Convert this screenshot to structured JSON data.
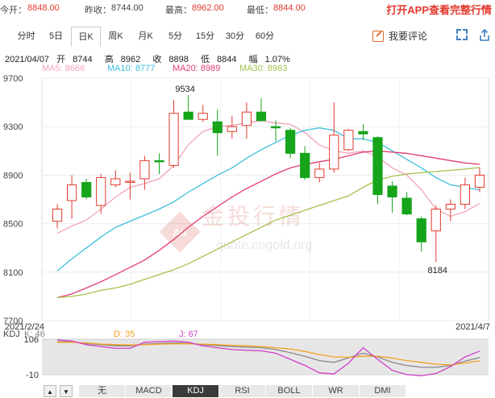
{
  "quote": {
    "open_label": "今开：",
    "open": "8848.00",
    "prev_close_label": "昨收：",
    "prev_close": "8744.00",
    "high_label": "最高：",
    "high": "8962.00",
    "low_label": "最低：",
    "low": "8844.00"
  },
  "promo": "打开APP查看完整行情",
  "tabs": [
    "分时",
    "5日",
    "日K",
    "周K",
    "月K",
    "5分",
    "15分",
    "30分",
    "60分"
  ],
  "active_tab": "日K",
  "comment_button": "我要评论",
  "ohlc": {
    "date": "2021/04/07",
    "open_label": "开",
    "open": "8744",
    "high_label": "高",
    "high": "8962",
    "close_label": "收",
    "close": "8898",
    "low_label": "低",
    "low": "8844",
    "change_label": "幅",
    "change": "1.07%"
  },
  "ma_legend": {
    "ma5": "MA5: 8666",
    "ma10": "MA10: 8777",
    "ma20": "MA20: 8989",
    "ma30": "MA30: 8963"
  },
  "colors": {
    "up": "#e23a2e",
    "down": "#15a41a",
    "ma5": "#f3a3b7",
    "ma10": "#3cbfe0",
    "ma20": "#e23d6f",
    "ma30": "#a3c24a",
    "k": "#888888",
    "d": "#f4a020",
    "j": "#d23fc8"
  },
  "watermark": {
    "cn": "金投行情",
    "url": "quote.cngold.org",
    "logo": "Au"
  },
  "chart_data": {
    "type": "candlestick",
    "ylim": [
      7700,
      9700
    ],
    "yticks": [
      9700,
      9300,
      8900,
      8500,
      8100,
      7700
    ],
    "x_start_label": "2021/2/24",
    "x_end_label": "2021/4/7",
    "max_label": "9534",
    "min_label": "8184",
    "candles": [
      {
        "o": 8520,
        "c": 8620,
        "h": 8660,
        "l": 8460
      },
      {
        "o": 8690,
        "c": 8820,
        "h": 8900,
        "l": 8540
      },
      {
        "o": 8840,
        "c": 8720,
        "h": 8870,
        "l": 8700
      },
      {
        "o": 8650,
        "c": 8880,
        "h": 8910,
        "l": 8580
      },
      {
        "o": 8820,
        "c": 8870,
        "h": 8940,
        "l": 8800
      },
      {
        "o": 8840,
        "c": 8850,
        "h": 8920,
        "l": 8700
      },
      {
        "o": 8870,
        "c": 9020,
        "h": 9060,
        "l": 8780
      },
      {
        "o": 9020,
        "c": 9010,
        "h": 9080,
        "l": 8910
      },
      {
        "o": 8980,
        "c": 9410,
        "h": 9520,
        "l": 8960
      },
      {
        "o": 9420,
        "c": 9360,
        "h": 9560,
        "l": 9360
      },
      {
        "o": 9360,
        "c": 9410,
        "h": 9480,
        "l": 9340
      },
      {
        "o": 9340,
        "c": 9250,
        "h": 9440,
        "l": 9060
      },
      {
        "o": 9260,
        "c": 9300,
        "h": 9390,
        "l": 9200
      },
      {
        "o": 9310,
        "c": 9420,
        "h": 9500,
        "l": 9200
      },
      {
        "o": 9420,
        "c": 9350,
        "h": 9534,
        "l": 9340
      },
      {
        "o": 9300,
        "c": 9290,
        "h": 9350,
        "l": 9180
      },
      {
        "o": 9270,
        "c": 9080,
        "h": 9290,
        "l": 9040
      },
      {
        "o": 9080,
        "c": 8880,
        "h": 9140,
        "l": 8860
      },
      {
        "o": 8880,
        "c": 8950,
        "h": 9000,
        "l": 8840
      },
      {
        "o": 8950,
        "c": 9230,
        "h": 9500,
        "l": 8920
      },
      {
        "o": 9110,
        "c": 9270,
        "h": 9280,
        "l": 9100
      },
      {
        "o": 9260,
        "c": 9240,
        "h": 9320,
        "l": 9190
      },
      {
        "o": 9210,
        "c": 8740,
        "h": 9220,
        "l": 8660
      },
      {
        "o": 8810,
        "c": 8720,
        "h": 8850,
        "l": 8590
      },
      {
        "o": 8710,
        "c": 8580,
        "h": 8760,
        "l": 8570
      },
      {
        "o": 8540,
        "c": 8350,
        "h": 8560,
        "l": 8270
      },
      {
        "o": 8440,
        "c": 8620,
        "h": 8650,
        "l": 8184
      },
      {
        "o": 8620,
        "c": 8660,
        "h": 8700,
        "l": 8520
      },
      {
        "o": 8660,
        "c": 8820,
        "h": 8880,
        "l": 8620
      },
      {
        "o": 8800,
        "c": 8900,
        "h": 8962,
        "l": 8760
      }
    ],
    "series": [
      {
        "name": "MA5",
        "values": [
          8420,
          8480,
          8530,
          8620,
          8720,
          8800,
          8830,
          8870,
          8980,
          9150,
          9260,
          9300,
          9310,
          9330,
          9350,
          9330,
          9320,
          9250,
          9150,
          9100,
          9080,
          9100,
          9050,
          8960,
          8900,
          8780,
          8620,
          8560,
          8600,
          8666
        ]
      },
      {
        "name": "MA10",
        "values": [
          8110,
          8210,
          8300,
          8390,
          8470,
          8520,
          8570,
          8620,
          8680,
          8760,
          8830,
          8900,
          8960,
          9040,
          9110,
          9170,
          9230,
          9270,
          9290,
          9270,
          9200,
          9200,
          9170,
          9100,
          9030,
          8960,
          8880,
          8820,
          8800,
          8777
        ]
      },
      {
        "name": "MA20",
        "values": [
          7890,
          7920,
          7970,
          8020,
          8080,
          8140,
          8200,
          8280,
          8370,
          8470,
          8560,
          8640,
          8720,
          8790,
          8850,
          8910,
          8960,
          8990,
          9010,
          9030,
          9060,
          9090,
          9100,
          9090,
          9080,
          9060,
          9040,
          9020,
          9000,
          8989
        ]
      },
      {
        "name": "MA30",
        "values": [
          7890,
          7900,
          7920,
          7950,
          7970,
          8000,
          8040,
          8080,
          8120,
          8170,
          8230,
          8290,
          8350,
          8410,
          8470,
          8530,
          8570,
          8610,
          8650,
          8690,
          8730,
          8800,
          8860,
          8890,
          8910,
          8920,
          8930,
          8940,
          8950,
          8963
        ]
      }
    ],
    "kdj": {
      "ylim": [
        -10,
        106
      ],
      "yticks": [
        106,
        -10
      ],
      "legend": {
        "k": "K: 46",
        "d": "D: 35",
        "j": "J: 67"
      },
      "K": [
        98,
        97,
        92,
        88,
        84,
        84,
        90,
        92,
        94,
        92,
        88,
        85,
        82,
        80,
        78,
        72,
        62,
        50,
        36,
        30,
        45,
        60,
        48,
        30,
        20,
        14,
        14,
        20,
        34,
        46
      ],
      "D": [
        96,
        96,
        94,
        90,
        88,
        87,
        88,
        90,
        91,
        91,
        90,
        88,
        86,
        84,
        82,
        78,
        74,
        66,
        56,
        48,
        47,
        50,
        50,
        44,
        36,
        30,
        24,
        22,
        28,
        35
      ],
      "J": [
        104,
        100,
        88,
        82,
        76,
        76,
        96,
        98,
        100,
        96,
        84,
        78,
        72,
        70,
        68,
        60,
        40,
        20,
        -4,
        -8,
        28,
        78,
        40,
        4,
        -10,
        -14,
        -6,
        16,
        48,
        67
      ]
    }
  },
  "indicator_tabs": [
    "无",
    "MACD",
    "KDJ",
    "RSI",
    "BOLL",
    "WR",
    "DMI"
  ],
  "active_indicator": "KDJ",
  "nav": {
    "up": "▲",
    "down": "▼"
  }
}
